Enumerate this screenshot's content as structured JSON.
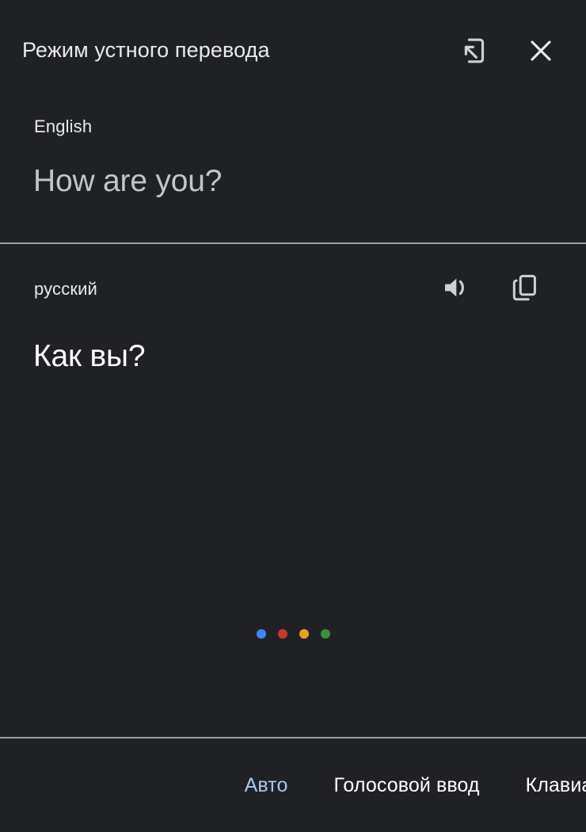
{
  "app": {
    "background_color": "#202124",
    "title": "Режим устного перевода"
  },
  "header": {
    "title": "Режим устного перевода",
    "actions": [
      {
        "name": "send-to-phone-icon",
        "label": "Отправить на телефон"
      },
      {
        "name": "close-icon",
        "label": "Закрыть"
      }
    ]
  },
  "source": {
    "language": "English",
    "text": "How are you?",
    "text_color": "#c2c5c9"
  },
  "target": {
    "language": "русский",
    "text": "Как вы?",
    "text_color": "#ffffff",
    "actions": [
      {
        "name": "speaker-icon",
        "label": "Прослушать"
      },
      {
        "name": "copy-icon",
        "label": "Копировать"
      }
    ]
  },
  "listening_indicator": {
    "dots": [
      {
        "color": "#4285f4",
        "name": "dot-blue"
      },
      {
        "color": "#c5392f",
        "name": "dot-red"
      },
      {
        "color": "#e8a022",
        "name": "dot-yellow"
      },
      {
        "color": "#3d8c40",
        "name": "dot-green"
      }
    ]
  },
  "bottom_bar": {
    "items": [
      {
        "label": "Авто",
        "active": true
      },
      {
        "label": "Голосовой ввод",
        "active": false
      },
      {
        "label": "Клавиатура",
        "active": false
      }
    ],
    "active_color": "#a8c7fa"
  },
  "dividers": {
    "color": "#9aa0a6"
  }
}
